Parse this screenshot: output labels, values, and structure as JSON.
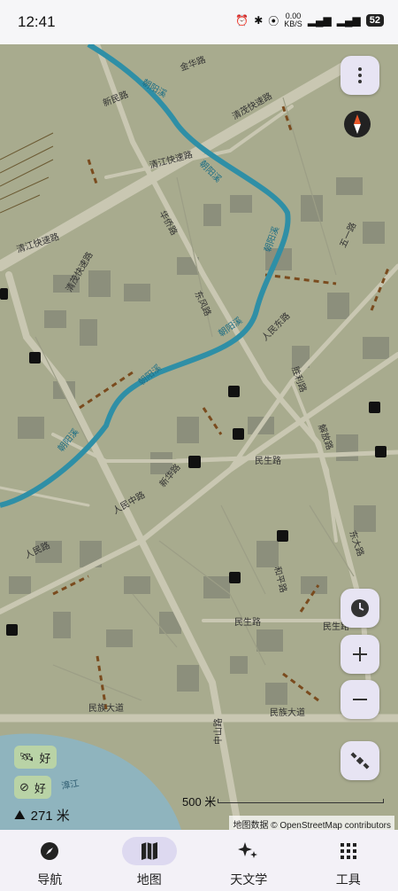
{
  "status": {
    "time": "12:41",
    "net_speed_value": "0.00",
    "net_speed_unit": "KB/S",
    "battery": "52"
  },
  "map": {
    "labels": {
      "xinmin_rd": "新民路",
      "qingjiang_kuaisu": "清江快速路",
      "qingjiang_kuaisu_2": "清江快速路",
      "qingmao_rd": "清茂快速路",
      "qingmao_rd_2": "清茂快速路",
      "jinhua_rd": "金华路",
      "chaoyang_creek_1": "朝阳溪",
      "chaoyang_creek_2": "朝阳溪",
      "chaoyang_creek_3": "朝阳溪",
      "chaoyang_creek_4": "朝阳溪",
      "chaoyang_creek_5": "朝阳溪",
      "chaoyang_creek_6": "朝阳溪",
      "huaqiao_rd": "华侨路",
      "dongfeng_rd": "东风路",
      "renmin_east_rd": "人民东路",
      "renmin_mid_rd": "人民中路",
      "renmin_rd": "人民路",
      "minsheng_rd": "民生路",
      "minsheng_rd_2": "民生路",
      "minsheng_rd_3": "民生路",
      "minzu_dadao": "民族大道",
      "minzu_dadao_2": "民族大道",
      "zhongshan_rd": "中山路",
      "xinhua_rd": "新华路",
      "shengli_rd": "胜利路",
      "jiefang_rd": "解放路",
      "wuyi_rd": "五一路",
      "dongda_rd": "东大路",
      "heping_rd": "和平路",
      "zhangjiang": "漳江"
    }
  },
  "controls": {
    "menu_icon": "more-vertical-icon",
    "compass_icon": "compass-needle-icon",
    "clock_icon": "clock-icon",
    "zoom_in_icon": "plus-icon",
    "zoom_out_icon": "minus-icon",
    "satellite_icon": "satellite-icon"
  },
  "gps": {
    "satellite_status": "好",
    "compass_status": "好"
  },
  "altitude": {
    "value": "271 米"
  },
  "scale": {
    "label": "500 米"
  },
  "attribution": "地图数据 © OpenStreetMap contributors",
  "nav": {
    "items": [
      {
        "label": "导航",
        "icon": "compass-icon"
      },
      {
        "label": "地图",
        "icon": "map-icon"
      },
      {
        "label": "天文学",
        "icon": "sparkles-icon"
      },
      {
        "label": "工具",
        "icon": "grid-icon"
      }
    ]
  },
  "colors": {
    "map_bg": "#a8ab8e",
    "road": "#c9c7b2",
    "river": "#2f8fa6",
    "water": "#8fb4be",
    "building": "#8c8f7c",
    "accent": "#ddd9f0"
  }
}
